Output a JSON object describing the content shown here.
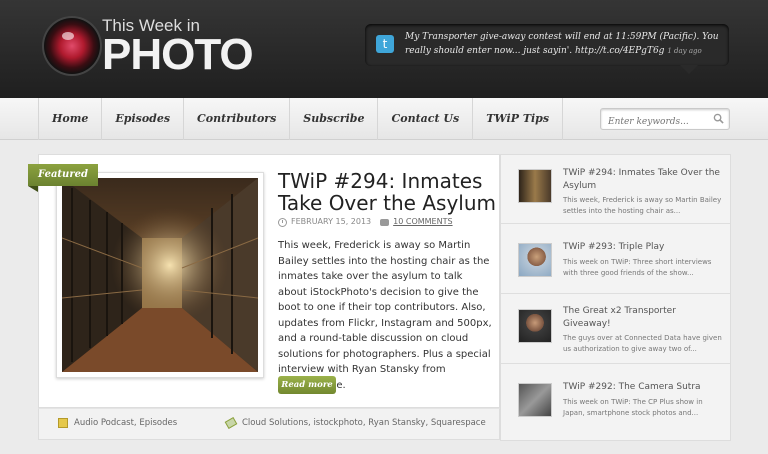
{
  "brand": {
    "name_top": "This Week in",
    "name_big": "PHOTO"
  },
  "tweet": {
    "text": "My Transporter give-away contest will end at 11:59PM (Pacific). You really should enter now... just sayin'. http://t.co/4EPgT6g",
    "time": "1 day ago",
    "icon": "twitter-icon"
  },
  "nav": {
    "items": [
      "Home",
      "Episodes",
      "Contributors",
      "Subscribe",
      "Contact Us",
      "TWiP Tips"
    ]
  },
  "search": {
    "placeholder": "Enter keywords..."
  },
  "featured": {
    "badge": "Featured",
    "title": "TWiP #294: Inmates Take Over the Asylum",
    "date": "FEBRUARY 15, 2013",
    "comments": "10 COMMENTS",
    "excerpt": "This week, Frederick is away so Martin Bailey settles into the hosting chair as the inmates take over the asylum to talk about iStockPhoto's decision to give the boot to one if their top contributors. Also, updates from Flickr, Instagram and 500px, and a round-table discussion on cloud solutions for photographers. Plus a special interview with Ryan Stansky from Squarespace.",
    "read_more": "Read more",
    "categories": "Audio Podcast, Episodes",
    "tags": "Cloud Solutions, istockphoto, Ryan Stansky, Squarespace"
  },
  "sidebar": {
    "items": [
      {
        "title": "TWiP #294: Inmates Take Over the Asylum",
        "desc": "This week, Frederick is away so Martin Bailey settles into the hosting chair as..."
      },
      {
        "title": "TWiP #293: Triple Play",
        "desc": "This week on TWiP: Three short interviews with three good friends of the show..."
      },
      {
        "title": "The Great x2 Transporter Giveaway!",
        "desc": "The guys over at Connected Data have given us authorization to give away two of..."
      },
      {
        "title": "TWiP #292: The Camera Sutra",
        "desc": "This week on TWiP: The CP Plus show in Japan, smartphone stock photos and..."
      }
    ]
  },
  "colors": {
    "header_bg": "#2a2a2a",
    "accent_green": "#7d9535",
    "twitter_blue": "#3fa6d9"
  }
}
